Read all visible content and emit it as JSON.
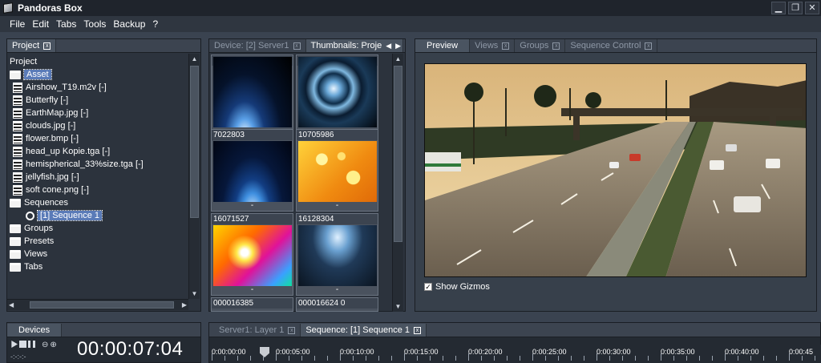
{
  "window": {
    "title": "Pandoras Box"
  },
  "menu": [
    "File",
    "Edit",
    "Tabs",
    "Tools",
    "Backup",
    "?"
  ],
  "project_panel": {
    "tab": "Project",
    "root": "Project",
    "asset_folder": "Asset",
    "assets": [
      "Airshow_T19.m2v [-]",
      "Butterfly [-]",
      "EarthMap.jpg [-]",
      "clouds.jpg [-]",
      "flower.bmp [-]",
      "head_up Kopie.tga [-]",
      "hemispherical_33%size.tga [-]",
      "jellyfish.jpg [-]",
      "soft cone.png [-]"
    ],
    "sequences_folder": "Sequences",
    "sequence_item": "[1] Sequence 1",
    "other_folders": [
      "Groups",
      "Presets",
      "Views",
      "Tabs"
    ]
  },
  "thumb_panel": {
    "tabs": [
      "Device: [2] Server1",
      "Thumbnails: Proje"
    ],
    "cells": [
      {
        "label": "",
        "caption": "-"
      },
      {
        "label": "",
        "caption": "-"
      },
      {
        "label": "7022803",
        "caption": "-"
      },
      {
        "label": "10705986",
        "caption": "-"
      },
      {
        "label": "16071527",
        "caption": "-"
      },
      {
        "label": "16128304",
        "caption": "-"
      },
      {
        "label": "000016385",
        "caption": ""
      },
      {
        "label": "000016624 0",
        "caption": ""
      }
    ]
  },
  "preview_panel": {
    "tabs": [
      "Preview",
      "Views",
      "Groups",
      "Sequence Control"
    ],
    "show_gizmos": "Show Gizmos"
  },
  "devices_panel": {
    "tab": "Devices",
    "sub": "-:-:-:-"
  },
  "timeline": {
    "tabs": [
      "Server1: Layer 1",
      "Sequence: [1] Sequence 1"
    ],
    "timecode": "00:00:07:04",
    "ruler": [
      "0:00:00:00",
      "0:00:05:00",
      "0:00:10:00",
      "0:00:15:00",
      "0:00:20:00",
      "0:00:25:00",
      "0:00:30:00",
      "0:00:35:00",
      "0:00:40:00",
      "0:00:45"
    ]
  }
}
